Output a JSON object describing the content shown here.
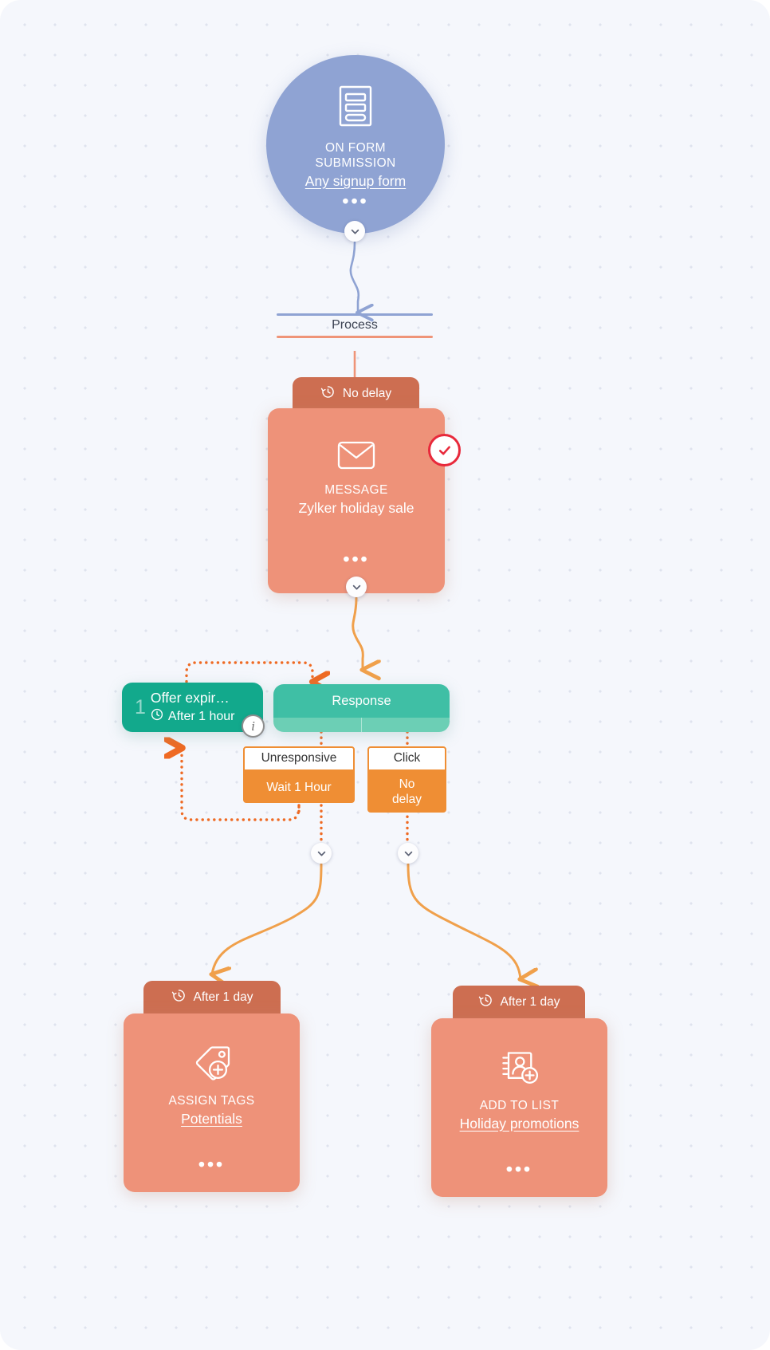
{
  "canvas": {
    "background": "#f5f7fc",
    "dot_color": "#dfe3ee"
  },
  "trigger": {
    "icon": "form-icon",
    "kind_line1": "ON FORM",
    "kind_line2": "SUBMISSION",
    "title": "Any signup form",
    "menu_dots": "•••",
    "color": "#8fa3d3"
  },
  "divider": {
    "label": "Process",
    "top_color": "#8fa3d3",
    "bottom_color": "#ef9478"
  },
  "message": {
    "delay_label": "No delay",
    "delay_icon": "clock-rewind-icon",
    "icon": "envelope-icon",
    "kind": "MESSAGE",
    "title": "Zylker holiday sale",
    "menu_dots": "•••",
    "status_badge": "check-circle",
    "badge_color": "#e8293b",
    "color": "#ee9279"
  },
  "offer": {
    "number": "1",
    "name": "Offer expir…",
    "time_icon": "clock-icon",
    "time": "After 1 hour",
    "info_badge": "i",
    "color": "#12a98c"
  },
  "response": {
    "label": "Response",
    "head_color": "#3fbfa5",
    "body_color": "#6ccfb5"
  },
  "branches": [
    {
      "head": "Unresponsive",
      "body": "Wait 1 Hour",
      "color": "#ef8e34"
    },
    {
      "head": "Click",
      "body": "No\ndelay",
      "color": "#ef8e34"
    }
  ],
  "actions": [
    {
      "delay_label": "After 1 day",
      "delay_icon": "clock-rewind-icon",
      "icon": "tag-plus-icon",
      "kind": "ASSIGN TAGS",
      "title": "Potentials",
      "menu_dots": "•••",
      "color": "#ee9279"
    },
    {
      "delay_label": "After 1 day",
      "delay_icon": "clock-rewind-icon",
      "icon": "add-contact-to-list-icon",
      "kind": "ADD TO LIST",
      "title": "Holiday promotions",
      "menu_dots": "•••",
      "color": "#ee9279"
    }
  ],
  "connectors": {
    "trigger_color": "#8fa3d3",
    "flow_color": "#f0a04b",
    "loop_color": "#ef6a23"
  }
}
